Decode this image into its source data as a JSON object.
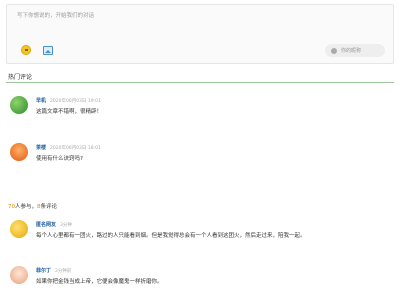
{
  "composer": {
    "placeholder": "写下你想说的，开始我们的对话",
    "nickname_placeholder": "你的昵称"
  },
  "section_title": "热门评论",
  "comments_top": [
    {
      "name": "早机",
      "time": "2020年06月03日 19:01",
      "text": "这篇文章不错啊，很精辟！",
      "avatar": "leaf-avatar"
    },
    {
      "name": "茶楼",
      "time": "2020年06月03日 18:01",
      "text": "使用有什么诀窍吗?",
      "avatar": "fox-avatar"
    }
  ],
  "stats": {
    "participants_count": "70",
    "participants_label": "人参与，",
    "comments_count": "8",
    "comments_label": "条评论"
  },
  "comments_bottom": [
    {
      "name": "匿名网友",
      "time": "3分钟",
      "text": "每个人心里都有一团火，路过的人只能看到烟。但是我觉得总会有一个人看到这团火，然后走过来，陪我一起。",
      "avatar": "smile-avatar"
    },
    {
      "name": "菲尔丁",
      "time": "2分钟前",
      "text": "如果你把金钱当成上帝，它便会像魔鬼一样折磨你。",
      "avatar": "clown-avatar"
    }
  ]
}
